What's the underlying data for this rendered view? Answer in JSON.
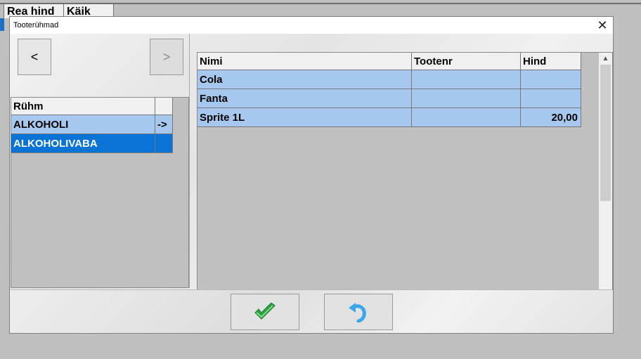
{
  "background": {
    "headers": [
      "Rea hind",
      "Käik"
    ]
  },
  "dialog": {
    "title": "Tooterühmad",
    "close_glyph": "✕"
  },
  "nav": {
    "prev_label": "<",
    "next_label": ">"
  },
  "groups": {
    "headers": [
      "Rühm",
      ""
    ],
    "rows": [
      {
        "name": "ALKOHOLI",
        "marker": "->",
        "selected": false
      },
      {
        "name": "ALKOHOLIVABA",
        "marker": "",
        "selected": true
      }
    ]
  },
  "products": {
    "headers": [
      "Nimi",
      "Tootenr",
      "Hind"
    ],
    "rows": [
      {
        "name": "Cola",
        "code": "",
        "price": ""
      },
      {
        "name": "Fanta",
        "code": "",
        "price": ""
      },
      {
        "name": "Sprite 1L",
        "code": "",
        "price": "20,00"
      }
    ]
  },
  "actions": {
    "ok_icon": "green-check-icon",
    "undo_icon": "undo-arrow-icon"
  },
  "colors": {
    "selected_row": "#0a74d6",
    "row_fill": "#a6c8ee",
    "ok_green": "#2ea043",
    "undo_blue": "#3aa7e8"
  }
}
